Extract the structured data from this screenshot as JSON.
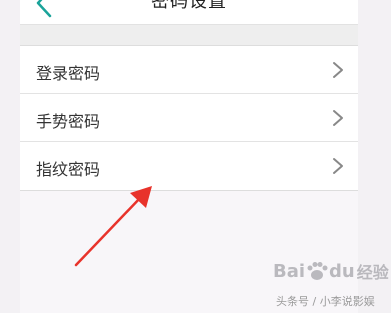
{
  "header": {
    "title": "密码设置",
    "back_icon": "chevron-left-icon"
  },
  "settings": {
    "items": [
      {
        "label": "登录密码",
        "icon": "chevron-right-icon"
      },
      {
        "label": "手势密码",
        "icon": "chevron-right-icon"
      },
      {
        "label": "指纹密码",
        "icon": "chevron-right-icon"
      }
    ]
  },
  "overlay": {
    "arrow_color": "#e8332b",
    "logo_text": "Bai",
    "logo_text_2": "du",
    "logo_cn": "经验",
    "watermark": "头条号 / 小李说影娱"
  },
  "colors": {
    "accent": "#1aa39a",
    "background": "#f7f5f8",
    "row_background": "#ffffff",
    "text": "#333333"
  }
}
